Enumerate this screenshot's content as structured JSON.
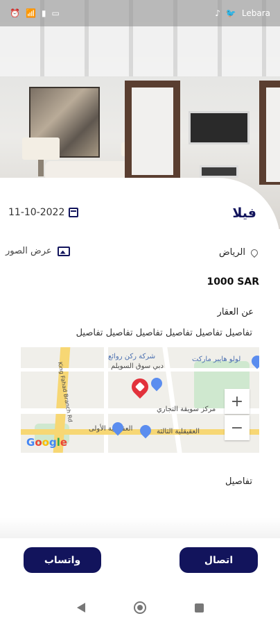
{
  "status_bar": {
    "carrier": "Lebara",
    "icons": [
      "wifi-icon",
      "signal-icon",
      "battery-icon",
      "tiktok-icon",
      "twitter-icon"
    ]
  },
  "listing": {
    "title": "فيلا",
    "date": "11-10-2022",
    "location": "الرياض",
    "view_photos": "عرض الصور",
    "price": "1000 SAR",
    "about_heading": "عن العقار",
    "about_text": "تفاصيل تفاصيل تفاصيل تفاصيل تفاصيل تفاصيل",
    "details_heading": "تفاصيل"
  },
  "map": {
    "labels": {
      "lulu": "لولو هايبر ماركت",
      "rukn": "شركة ركن روائع",
      "souq": "دبي سوق السويلم",
      "markaz": "مركز سويقة التجاري",
      "aqiq3": "العقيقلية الثالثة",
      "aqiq1": "العقيقلية الأولى",
      "road": "King Fahad Branch Rd"
    },
    "zoom_in": "+",
    "zoom_out": "−",
    "brand": [
      "G",
      "o",
      "o",
      "g",
      "l",
      "e"
    ]
  },
  "actions": {
    "call": "اتصال",
    "whatsapp": "واتساب"
  },
  "colors": {
    "primary": "#12145c",
    "pin": "#e2323c"
  }
}
